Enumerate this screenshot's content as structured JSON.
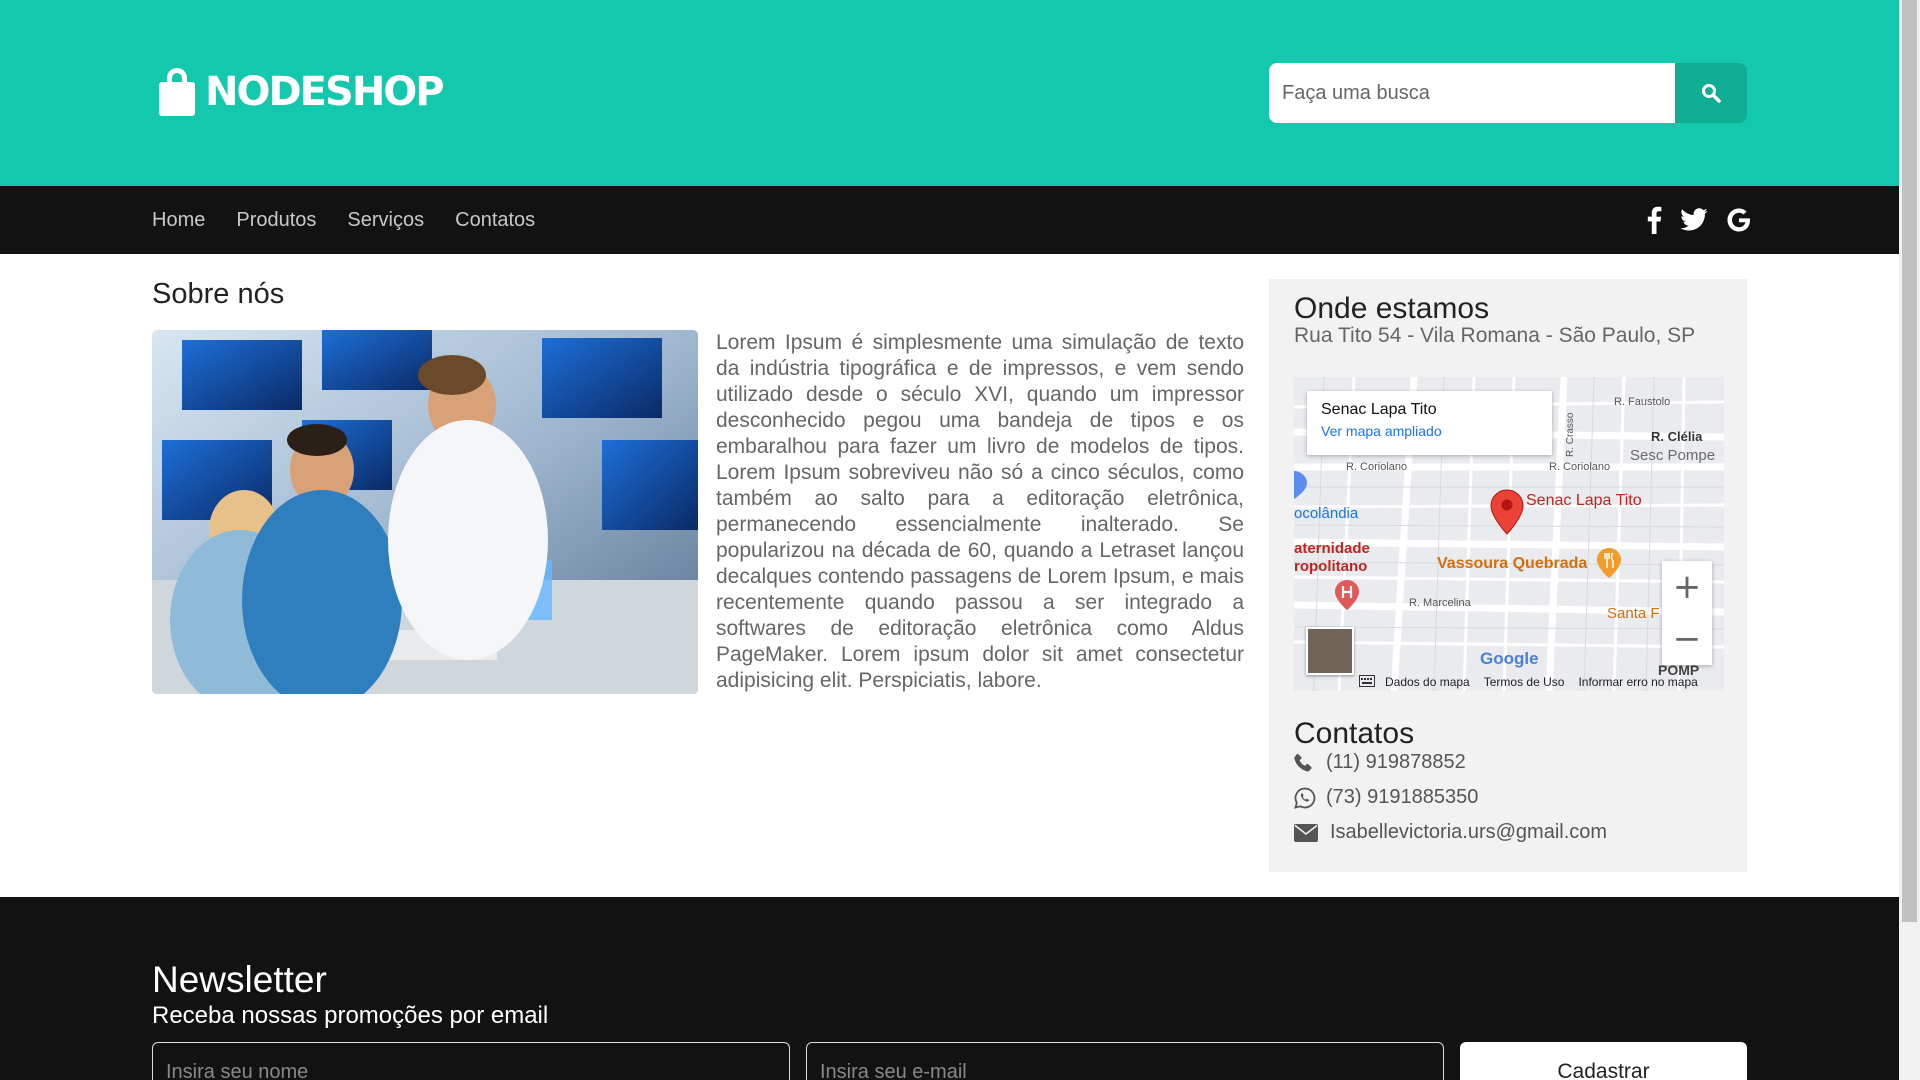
{
  "header": {
    "logo_text": "NODESHOP",
    "search_placeholder": "Faça uma busca"
  },
  "nav": {
    "items": [
      {
        "label": "Home"
      },
      {
        "label": "Produtos"
      },
      {
        "label": "Serviços"
      },
      {
        "label": "Contatos"
      }
    ],
    "social": [
      "facebook-icon",
      "twitter-icon",
      "google-icon"
    ]
  },
  "about": {
    "title": "Sobre nós",
    "text": "Lorem Ipsum é simplesmente uma simulação de texto da indústria tipográfica e de impressos, e vem sendo utilizado desde o século XVI, quando um impressor desconhecido pegou uma bandeja de tipos e os embaralhou para fazer um livro de modelos de tipos. Lorem Ipsum sobreviveu não só a cinco séculos, como também ao salto para a editoração eletrônica, permanecendo essencialmente inalterado. Se popularizou na década de 60, quando a Letraset lançou decalques contendo passagens de Lorem Ipsum, e mais recentemente quando passou a ser integrado a softwares de editoração eletrônica como Aldus PageMaker. Lorem ipsum dolor sit amet consectetur adipisicing elit. Perspiciatis, labore."
  },
  "location": {
    "title": "Onde estamos",
    "address": "Rua Tito 54 - Vila Romana - São Paulo, SP",
    "map": {
      "place_name": "Senac Lapa Tito",
      "larger_map_link": "Ver mapa ampliado",
      "marker_label": "Senac Lapa Tito",
      "labels": {
        "r_faustolo": "R. Faustolo",
        "r_clelia": "R. Clélia",
        "sesc": "Sesc Pompe",
        "r_coriolano_1": "R. Coriolano",
        "r_coriolano_2": "R. Coriolano",
        "r_crasso": "R. Crasso",
        "colandia": "ocolândia",
        "maternidade": "aternidade",
        "metropolitano": "ropolitano",
        "vassoura": "Vassoura Quebrada",
        "r_marcelina": "R. Marcelina",
        "santa": "Santa F",
        "pomp": "POMP",
        "google": "Google"
      },
      "footer": [
        "Dados do mapa",
        "Termos de Uso",
        "Informar erro no mapa"
      ],
      "zoom_in": "+",
      "zoom_out": "−"
    }
  },
  "contacts": {
    "title": "Contatos",
    "phone": "(11) 919878852",
    "whatsapp": "(73) 9191885350",
    "email": "Isabellevictoria.urs@gmail.com"
  },
  "newsletter": {
    "title": "Newsletter",
    "subtitle": "Receba nossas promoções por email",
    "name_placeholder": "Insira seu nome",
    "email_placeholder": "Insira seu e-mail",
    "button": "Cadastrar"
  },
  "colors": {
    "header": "#14c8ad",
    "nav": "#121212",
    "search_button": "#10ad95",
    "marker": "#ea4335"
  }
}
